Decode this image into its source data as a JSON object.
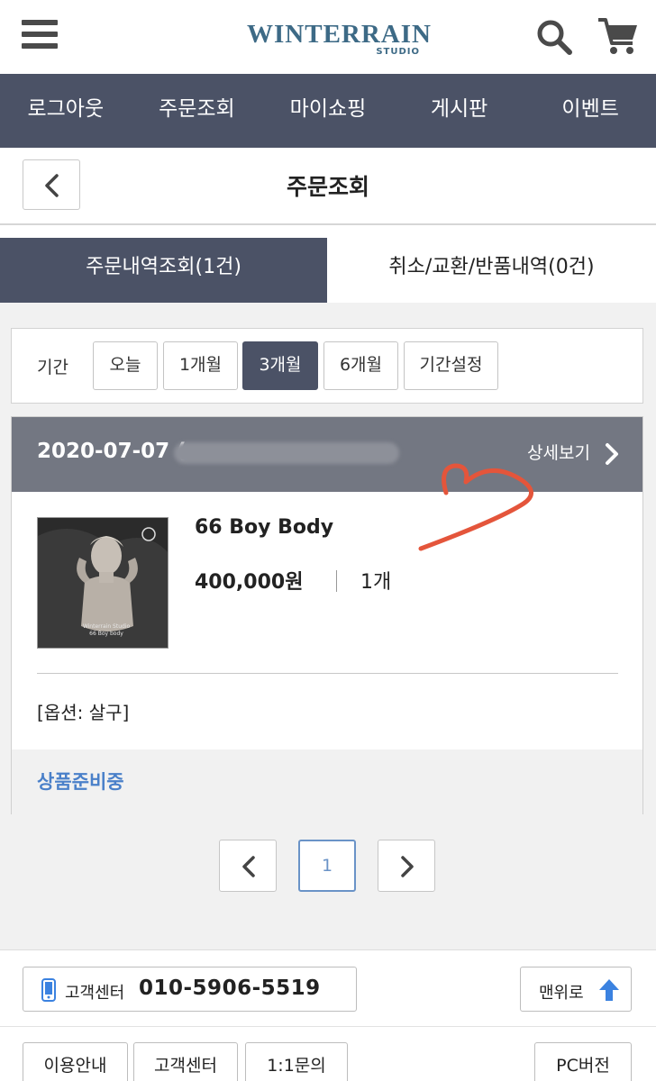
{
  "header": {
    "logo_main": "WINTERRAIN",
    "logo_sub": "STUDIO",
    "menu_icon": "hamburger-menu-icon",
    "search_icon": "search-icon",
    "cart_icon": "cart-icon"
  },
  "nav": {
    "items": [
      {
        "label": "로그아웃"
      },
      {
        "label": "주문조회"
      },
      {
        "label": "마이쇼핑"
      },
      {
        "label": "게시판"
      },
      {
        "label": "이벤트"
      }
    ]
  },
  "title_bar": {
    "title": "주문조회"
  },
  "tabs": [
    {
      "label": "주문내역조회(1건)",
      "active": true
    },
    {
      "label": "취소/교환/반품내역(0건)",
      "active": false
    }
  ],
  "period": {
    "label": "기간",
    "options": [
      "오늘",
      "1개월",
      "3개월",
      "6개월",
      "기간설정"
    ],
    "selected": "3개월"
  },
  "order": {
    "date": "2020-07-07 (",
    "detail_label": "상세보기",
    "product_name": "66 Boy Body",
    "price": "400,000원",
    "quantity": "1개",
    "option": "[옵션: 살구]",
    "status": "상품준비중",
    "thumb_caption_1": "Winterrain Studio",
    "thumb_caption_2": "66 Boy body"
  },
  "pagination": {
    "current": "1"
  },
  "footer": {
    "cs_label": "고객센터",
    "cs_number": "010-5906-5519",
    "top_label": "맨위로",
    "links": [
      "이용안내",
      "고객센터",
      "1:1문의"
    ],
    "pc_label": "PC버전"
  },
  "colors": {
    "nav_bg": "#4b5266",
    "order_head_bg": "#737782",
    "status": "#4a80c9",
    "logo": "#3d6a86",
    "heart": "#e4553b"
  }
}
